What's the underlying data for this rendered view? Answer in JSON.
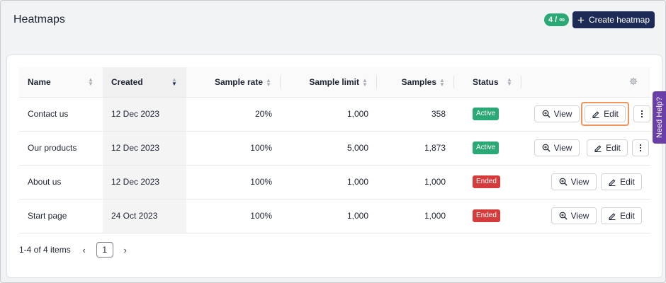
{
  "header": {
    "title": "Heatmaps",
    "quota_badge": "4 / ∞",
    "create_button": "Create heatmap"
  },
  "help_tab": "Need Help?",
  "table": {
    "columns": [
      "Name",
      "Created",
      "Sample rate",
      "Sample limit",
      "Samples",
      "Status"
    ],
    "rows": [
      {
        "name": "Contact us",
        "created": "12 Dec 2023",
        "sample_rate": "20%",
        "sample_limit": "1,000",
        "samples": "358",
        "status": "Active"
      },
      {
        "name": "Our products",
        "created": "12 Dec 2023",
        "sample_rate": "100%",
        "sample_limit": "5,000",
        "samples": "1,873",
        "status": "Active"
      },
      {
        "name": "About us",
        "created": "12 Dec 2023",
        "sample_rate": "100%",
        "sample_limit": "1,000",
        "samples": "1,000",
        "status": "Ended"
      },
      {
        "name": "Start page",
        "created": "24 Oct 2023",
        "sample_rate": "100%",
        "sample_limit": "1,000",
        "samples": "1,000",
        "status": "Ended"
      }
    ],
    "view_label": "View",
    "edit_label": "Edit"
  },
  "pagination": {
    "summary": "1-4 of 4 items",
    "current_page": "1"
  },
  "colors": {
    "primary": "#1c2a55",
    "active": "#2aa876",
    "ended": "#d63b3b",
    "highlight": "#f0945a",
    "help_tab": "#6b3fa8"
  }
}
